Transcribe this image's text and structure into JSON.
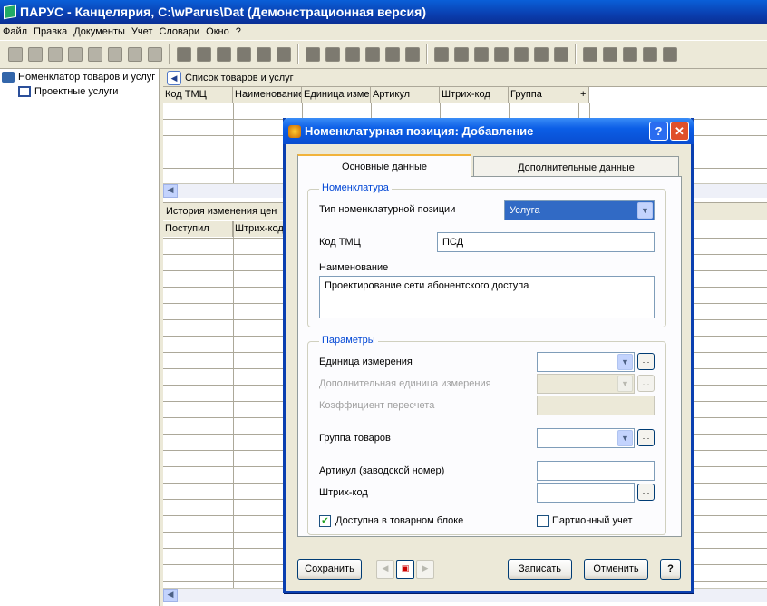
{
  "window": {
    "title": "ПАРУС - Канцелярия, C:\\wParus\\Dat (Демонстрационная версия)"
  },
  "menu": [
    "Файл",
    "Правка",
    "Документы",
    "Учет",
    "Словари",
    "Окно",
    "?"
  ],
  "tree": {
    "root": "Номенклатор товаров и услуг",
    "child": "Проектные услуги"
  },
  "list": {
    "title": "Список товаров и услуг",
    "columns": [
      "Код ТМЦ",
      "Наименование",
      "Единица измерения",
      "Артикул",
      "Штрих-код",
      "Группа",
      "+"
    ]
  },
  "history": {
    "title": "История изменения цен",
    "columns": [
      "Поступил",
      "Штрих-код"
    ]
  },
  "dialog": {
    "title": "Номенклатурная позиция: Добавление",
    "help_label": "?",
    "close_label": "✕",
    "tabs": [
      "Основные данные",
      "Дополнительные данные"
    ],
    "group_nomenclature": "Номенклатура",
    "type_label": "Тип номенклатурной позиции",
    "type_value": "Услуга",
    "code_label": "Код ТМЦ",
    "code_value": "ПСД",
    "name_label": "Наименование",
    "name_value": "Проектирование сети абонентского доступа",
    "group_params": "Параметры",
    "unit_label": "Единица измерения",
    "unit_value": "",
    "addunit_label": "Дополнительная единица измерения",
    "coef_label": "Коэффициент пересчета",
    "goods_group_label": "Группа товаров",
    "article_label": "Артикул (заводской номер)",
    "barcode_label": "Штрих-код",
    "available_label": "Доступна в товарном блоке",
    "available_checked": true,
    "batch_label": "Партионный учет",
    "batch_checked": false,
    "save_label": "Сохранить",
    "write_label": "Записать",
    "cancel_label": "Отменить",
    "help_button": "?"
  }
}
